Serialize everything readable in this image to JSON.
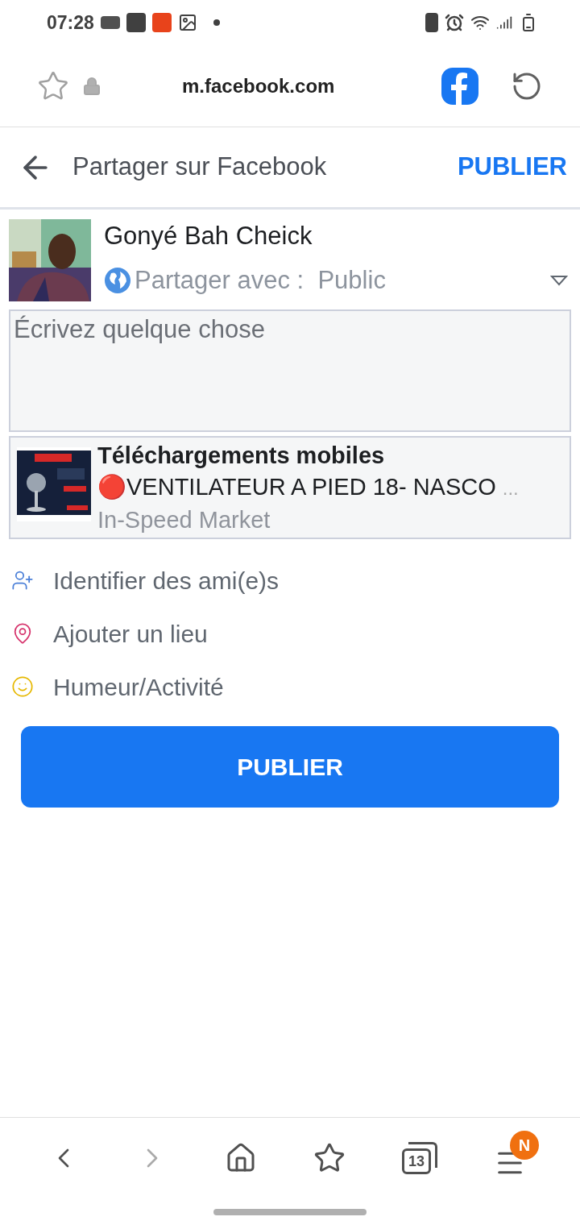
{
  "status_bar": {
    "time": "07:28"
  },
  "browser": {
    "url": "m.facebook.com"
  },
  "header": {
    "title": "Partager sur Facebook",
    "action": "PUBLIER"
  },
  "composer": {
    "user_name": "Gonyé Bah Cheick",
    "audience_label": "Partager avec :",
    "audience": "Public",
    "placeholder": "Écrivez quelque chose"
  },
  "link_preview": {
    "title": "Téléchargements mobiles",
    "description": "🔴VENTILATEUR A PIED 18- NASCO",
    "ellipsis": "...",
    "source": "In-Speed Market"
  },
  "options": [
    {
      "kind": "tag",
      "label": "Identifier des ami(e)s"
    },
    {
      "kind": "place",
      "label": "Ajouter un lieu"
    },
    {
      "kind": "mood",
      "label": "Humeur/Activité"
    }
  ],
  "publish_button": "PUBLIER",
  "bottom_nav": [
    {
      "kind": "back",
      "disabled": false
    },
    {
      "kind": "forward",
      "disabled": true
    },
    {
      "kind": "home",
      "disabled": false
    },
    {
      "kind": "bookmarks",
      "disabled": false
    },
    {
      "kind": "tabs",
      "count": "13",
      "disabled": false
    },
    {
      "kind": "menu",
      "badge": "N",
      "disabled": false
    }
  ]
}
